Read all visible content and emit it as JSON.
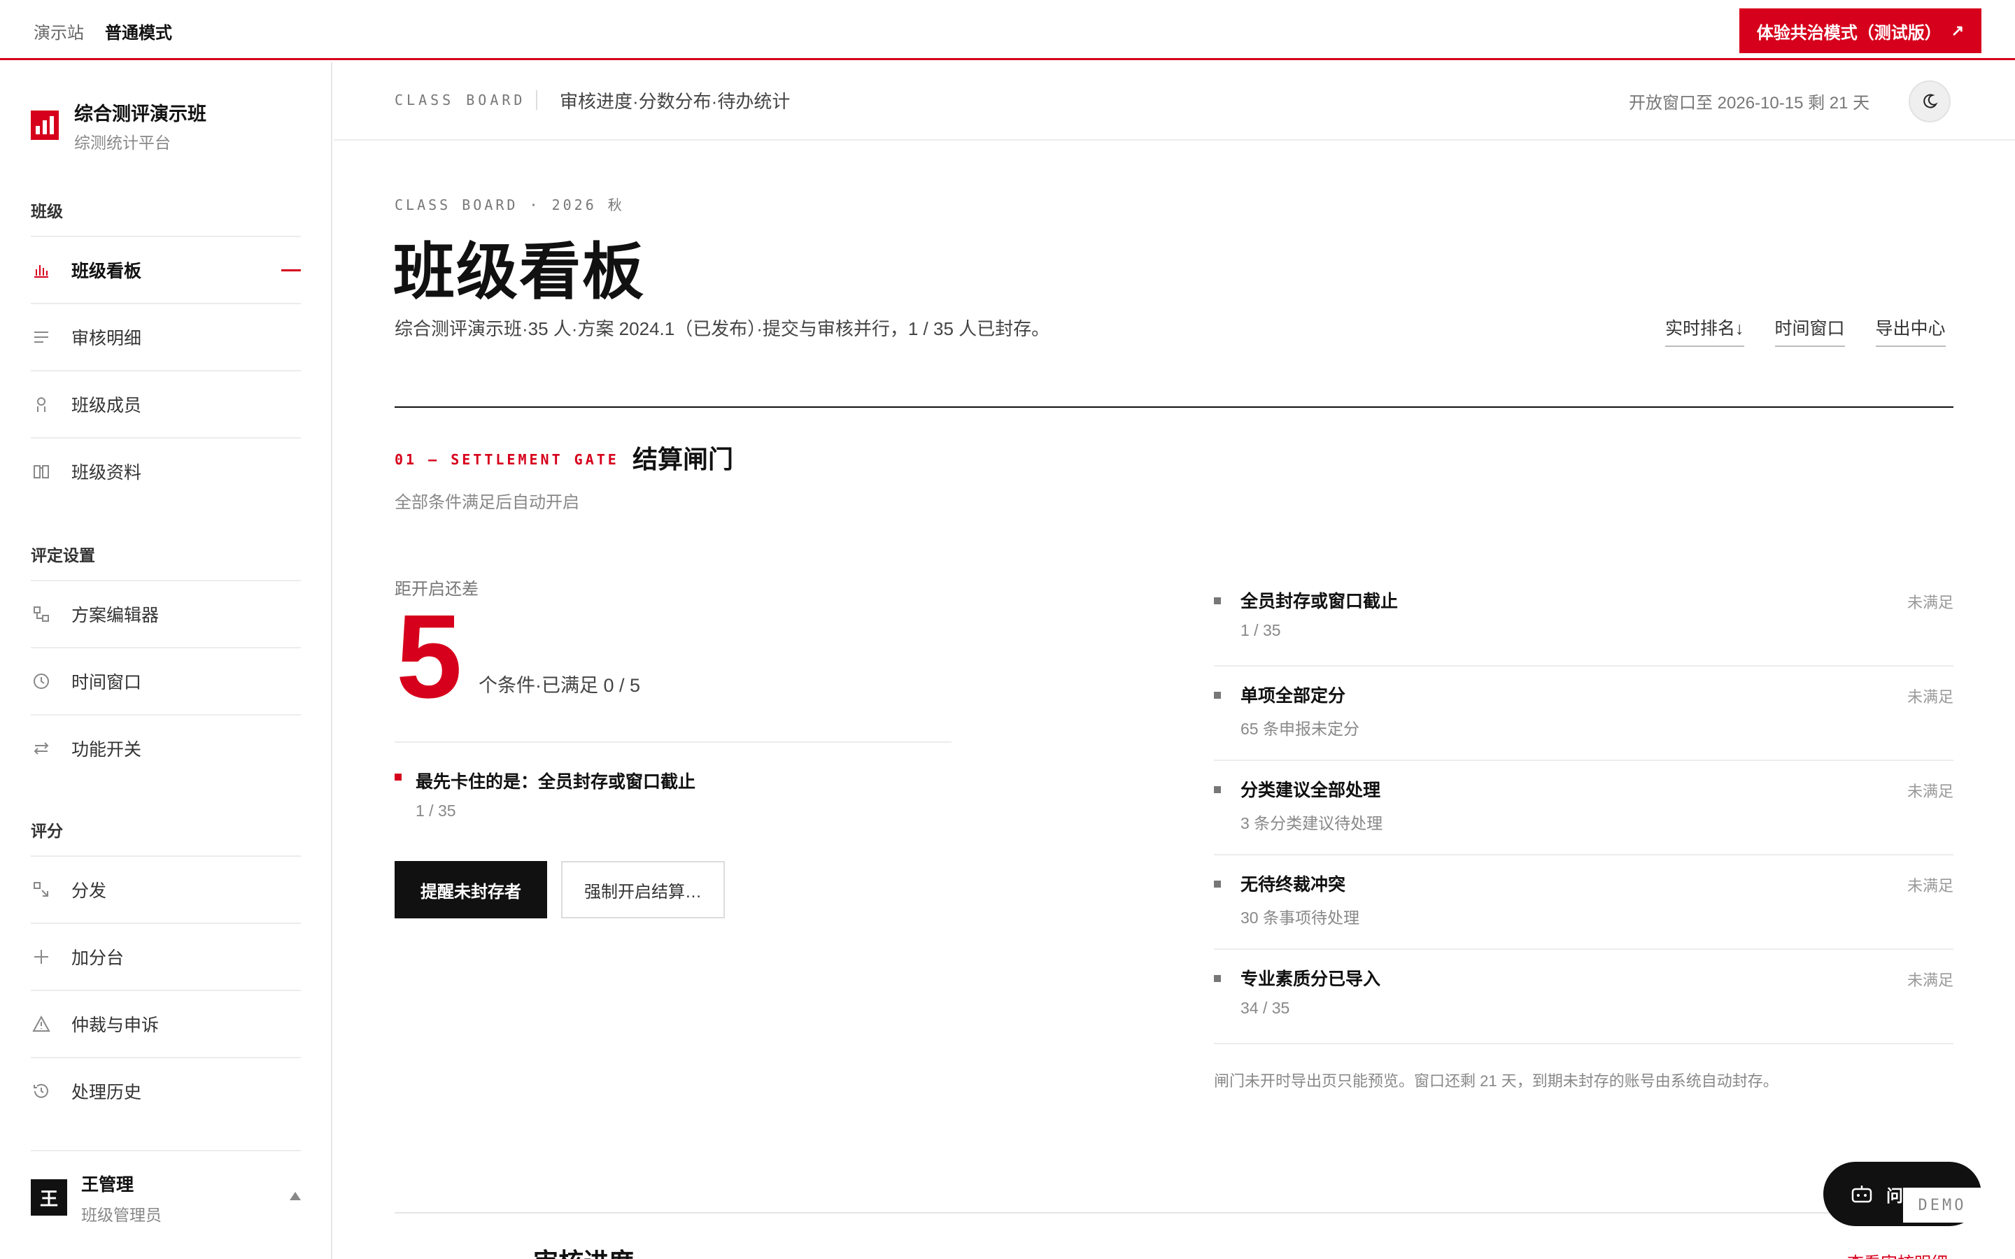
{
  "topbar": {
    "brand": "演示站",
    "mode": "普通模式",
    "cta_label": "体验共治模式（测试版）",
    "cta_icon": "arrow-up-right-icon"
  },
  "sidebar": {
    "title": "综合测评演示班",
    "subtitle": "综测统计平台",
    "groups": [
      {
        "label": "班级",
        "items": [
          {
            "label": "班级看板",
            "icon": "bar-chart-icon",
            "active": true
          },
          {
            "label": "审核明细",
            "icon": "list-icon"
          },
          {
            "label": "班级成员",
            "icon": "person-icon"
          },
          {
            "label": "班级资料",
            "icon": "book-icon"
          }
        ]
      },
      {
        "label": "评定设置",
        "items": [
          {
            "label": "方案编辑器",
            "icon": "nodes-icon"
          },
          {
            "label": "时间窗口",
            "icon": "clock-icon"
          },
          {
            "label": "功能开关",
            "icon": "switch-icon"
          }
        ]
      },
      {
        "label": "评分",
        "items": [
          {
            "label": "分发",
            "icon": "distribute-icon"
          },
          {
            "label": "加分台",
            "icon": "plus-icon"
          },
          {
            "label": "仲裁与申诉",
            "icon": "warning-icon"
          },
          {
            "label": "处理历史",
            "icon": "history-icon"
          }
        ]
      }
    ],
    "user": {
      "avatar": "王",
      "name": "王管理",
      "role": "班级管理员"
    }
  },
  "header": {
    "kicker": "CLASS BOARD",
    "crumb": "审核进度·分数分布·待办统计",
    "window": "开放窗口至 2026-10-15  剩  21  天",
    "theme_icon": "moon-icon"
  },
  "page": {
    "kicker": "CLASS BOARD · 2026 秋",
    "title": "班级看板",
    "desc": "综合测评演示班·35 人·方案 2024.1（已发布）·提交与审核并行，1 / 35 人已封存。",
    "links": [
      "实时排名↓",
      "时间窗口",
      "导出中心"
    ]
  },
  "gate": {
    "kicker": "01 — SETTLEMENT GATE",
    "title": "结算闸门",
    "subtitle": "全部条件满足后自动开启",
    "gap_label": "距开启还差",
    "remaining": "5",
    "remaining_note": "个条件·已满足 0 / 5",
    "blocker_title": "最先卡住的是：全员封存或窗口截止",
    "blocker_value": "1 / 35",
    "btn_primary": "提醒未封存者",
    "btn_secondary": "强制开启结算…",
    "conditions": [
      {
        "title": "全员封存或窗口截止",
        "value": "1 / 35",
        "status": "未满足"
      },
      {
        "title": "单项全部定分",
        "value": "65 条申报未定分",
        "status": "未满足"
      },
      {
        "title": "分类建议全部处理",
        "value": "3 条分类建议待处理",
        "status": "未满足"
      },
      {
        "title": "无待终裁冲突",
        "value": "30 条事项待处理",
        "status": "未满足"
      },
      {
        "title": "专业素质分已导入",
        "value": "34 / 35",
        "status": "未满足"
      }
    ],
    "note": "闸门未开时导出页只能预览。窗口还剩 21 天，到期未封存的账号由系统自动封存。"
  },
  "next_section": {
    "title": "审核进度",
    "link": "查看审核明细"
  },
  "fab": {
    "label": "问",
    "icon": "robot-icon",
    "badge": "DEMO"
  },
  "colors": {
    "accent": "#d6001c",
    "ink": "#111111",
    "muted": "#888888"
  }
}
